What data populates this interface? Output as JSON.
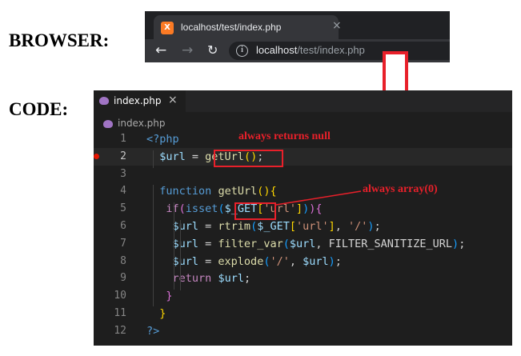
{
  "labels": {
    "browser": "BROWSER:",
    "code": "CODE:"
  },
  "browser": {
    "tab_title": "localhost/test/index.php",
    "tab_close": "×",
    "favicon_text": "X",
    "favicon_color": "#fb7a24",
    "nav": {
      "back_icon": "←",
      "forward_icon": "→",
      "reload_icon": "↻"
    },
    "address": {
      "info_icon": "i",
      "host": "localhost",
      "path": "/test/index.php"
    }
  },
  "editor": {
    "tab_label": "index.php",
    "tab_close": "×",
    "breadcrumb": "index.php",
    "active_line": 2,
    "breakpoint_line": 2,
    "lines": [
      {
        "n": "1",
        "tokens": [
          {
            "t": "<?php",
            "c": "t-kw"
          }
        ]
      },
      {
        "n": "2",
        "tokens": [
          {
            "t": "  ",
            "c": "t-pl"
          },
          {
            "t": "$url",
            "c": "t-var"
          },
          {
            "t": " = ",
            "c": "t-pl"
          },
          {
            "t": "getUrl",
            "c": "t-fn"
          },
          {
            "t": "()",
            "c": "t-br1"
          },
          {
            "t": ";",
            "c": "t-pl"
          }
        ]
      },
      {
        "n": "3",
        "tokens": []
      },
      {
        "n": "4",
        "tokens": [
          {
            "t": "  ",
            "c": "t-pl"
          },
          {
            "t": "function",
            "c": "t-kw"
          },
          {
            "t": " ",
            "c": "t-pl"
          },
          {
            "t": "getUrl",
            "c": "t-fn"
          },
          {
            "t": "(){",
            "c": "t-br1"
          }
        ]
      },
      {
        "n": "5",
        "tokens": [
          {
            "t": "   ",
            "c": "t-pl"
          },
          {
            "t": "if",
            "c": "t-ctl"
          },
          {
            "t": "(",
            "c": "t-br2"
          },
          {
            "t": "isset",
            "c": "t-kw"
          },
          {
            "t": "(",
            "c": "t-br3"
          },
          {
            "t": "$_GET",
            "c": "t-var"
          },
          {
            "t": "[",
            "c": "t-br1"
          },
          {
            "t": "'url'",
            "c": "t-str"
          },
          {
            "t": "]",
            "c": "t-br1"
          },
          {
            "t": ")",
            "c": "t-br3"
          },
          {
            "t": ")",
            "c": "t-br2"
          },
          {
            "t": "{",
            "c": "t-br2"
          }
        ]
      },
      {
        "n": "6",
        "tokens": [
          {
            "t": "    ",
            "c": "t-pl"
          },
          {
            "t": "$url",
            "c": "t-var"
          },
          {
            "t": " = ",
            "c": "t-pl"
          },
          {
            "t": "rtrim",
            "c": "t-fn"
          },
          {
            "t": "(",
            "c": "t-br3"
          },
          {
            "t": "$_GET",
            "c": "t-var"
          },
          {
            "t": "[",
            "c": "t-br1"
          },
          {
            "t": "'url'",
            "c": "t-str"
          },
          {
            "t": "]",
            "c": "t-br1"
          },
          {
            "t": ", ",
            "c": "t-pl"
          },
          {
            "t": "'/'",
            "c": "t-str"
          },
          {
            "t": ")",
            "c": "t-br3"
          },
          {
            "t": ";",
            "c": "t-pl"
          }
        ]
      },
      {
        "n": "7",
        "tokens": [
          {
            "t": "    ",
            "c": "t-pl"
          },
          {
            "t": "$url",
            "c": "t-var"
          },
          {
            "t": " = ",
            "c": "t-pl"
          },
          {
            "t": "filter_var",
            "c": "t-fn"
          },
          {
            "t": "(",
            "c": "t-br3"
          },
          {
            "t": "$url",
            "c": "t-var"
          },
          {
            "t": ", FILTER_SANITIZE_URL",
            "c": "t-pl"
          },
          {
            "t": ")",
            "c": "t-br3"
          },
          {
            "t": ";",
            "c": "t-pl"
          }
        ]
      },
      {
        "n": "8",
        "tokens": [
          {
            "t": "    ",
            "c": "t-pl"
          },
          {
            "t": "$url",
            "c": "t-var"
          },
          {
            "t": " = ",
            "c": "t-pl"
          },
          {
            "t": "explode",
            "c": "t-fn"
          },
          {
            "t": "(",
            "c": "t-br3"
          },
          {
            "t": "'/'",
            "c": "t-str"
          },
          {
            "t": ", ",
            "c": "t-pl"
          },
          {
            "t": "$url",
            "c": "t-var"
          },
          {
            "t": ")",
            "c": "t-br3"
          },
          {
            "t": ";",
            "c": "t-pl"
          }
        ]
      },
      {
        "n": "9",
        "tokens": [
          {
            "t": "    ",
            "c": "t-pl"
          },
          {
            "t": "return",
            "c": "t-ctl"
          },
          {
            "t": " ",
            "c": "t-pl"
          },
          {
            "t": "$url",
            "c": "t-var"
          },
          {
            "t": ";",
            "c": "t-pl"
          }
        ]
      },
      {
        "n": "10",
        "tokens": [
          {
            "t": "   ",
            "c": "t-pl"
          },
          {
            "t": "}",
            "c": "t-br2"
          }
        ]
      },
      {
        "n": "11",
        "tokens": [
          {
            "t": "  ",
            "c": "t-pl"
          },
          {
            "t": "}",
            "c": "t-br1"
          }
        ]
      },
      {
        "n": "12",
        "tokens": [
          {
            "t": "?>",
            "c": "t-kw"
          }
        ]
      }
    ]
  },
  "annotations": {
    "returns_null": "always returns null",
    "array_zero": "always array(0)",
    "color": "#e8202a"
  }
}
